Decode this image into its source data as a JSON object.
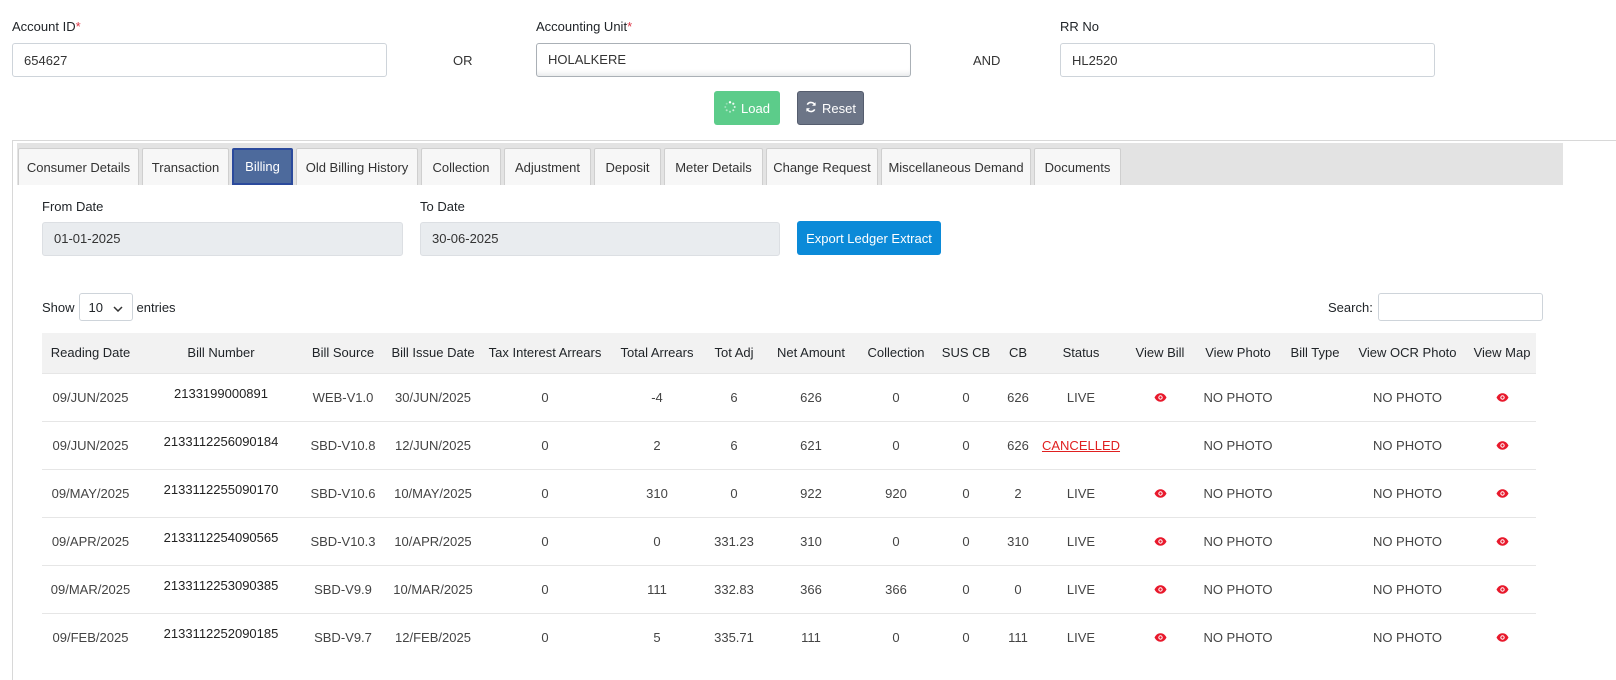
{
  "form": {
    "account_id": {
      "label": "Account ID",
      "required": "*",
      "value": "654627"
    },
    "or_label": "OR",
    "accounting_unit": {
      "label": "Accounting Unit",
      "required": "*",
      "value": "HOLALKERE"
    },
    "and_label": "AND",
    "rr_no": {
      "label": "RR No",
      "value": "HL2520"
    },
    "load_label": "Load",
    "reset_label": "Reset"
  },
  "tabs": [
    {
      "label": "Consumer Details"
    },
    {
      "label": "Transaction"
    },
    {
      "label": "Billing",
      "active": true
    },
    {
      "label": "Old Billing History"
    },
    {
      "label": "Collection"
    },
    {
      "label": "Adjustment"
    },
    {
      "label": "Deposit"
    },
    {
      "label": "Meter Details"
    },
    {
      "label": "Change Request"
    },
    {
      "label": "Miscellaneous Demand"
    },
    {
      "label": "Documents"
    }
  ],
  "billing": {
    "from_date_label": "From Date",
    "from_date": "01-01-2025",
    "to_date_label": "To Date",
    "to_date": "30-06-2025",
    "export_label": "Export Ledger Extract",
    "show_label": "Show",
    "entries_value": "10",
    "entries_label": "entries",
    "search_label": "Search:"
  },
  "table": {
    "headers": [
      "Reading Date",
      "Bill Number",
      "Bill Source",
      "Bill Issue Date",
      "Tax Interest Arrears",
      "Total Arrears",
      "Tot Adj",
      "Net Amount",
      "Collection",
      "SUS CB",
      "CB",
      "Status",
      "View Bill",
      "View Photo",
      "Bill Type",
      "View OCR Photo",
      "View Map"
    ],
    "rows": [
      {
        "reading_date": "09/JUN/2025",
        "bill_number": "2133199000891",
        "bill_source": "WEB-V1.0",
        "bill_issue_date": "30/JUN/2025",
        "tax_interest_arrears": "0",
        "total_arrears": "-4",
        "tot_adj": "6",
        "net_amount": "626",
        "collection": "0",
        "sus_cb": "0",
        "cb": "626",
        "status": "LIVE",
        "view_bill": true,
        "view_photo": "NO PHOTO",
        "bill_type": "",
        "view_ocr_photo": "NO PHOTO",
        "view_map": true
      },
      {
        "reading_date": "09/JUN/2025",
        "bill_number": "2133112256090184",
        "bill_source": "SBD-V10.8",
        "bill_issue_date": "12/JUN/2025",
        "tax_interest_arrears": "0",
        "total_arrears": "2",
        "tot_adj": "6",
        "net_amount": "621",
        "collection": "0",
        "sus_cb": "0",
        "cb": "626",
        "status": "CANCELLED",
        "view_bill": false,
        "view_photo": "NO PHOTO",
        "bill_type": "",
        "view_ocr_photo": "NO PHOTO",
        "view_map": true
      },
      {
        "reading_date": "09/MAY/2025",
        "bill_number": "2133112255090170",
        "bill_source": "SBD-V10.6",
        "bill_issue_date": "10/MAY/2025",
        "tax_interest_arrears": "0",
        "total_arrears": "310",
        "tot_adj": "0",
        "net_amount": "922",
        "collection": "920",
        "sus_cb": "0",
        "cb": "2",
        "status": "LIVE",
        "view_bill": true,
        "view_photo": "NO PHOTO",
        "bill_type": "",
        "view_ocr_photo": "NO PHOTO",
        "view_map": true
      },
      {
        "reading_date": "09/APR/2025",
        "bill_number": "2133112254090565",
        "bill_source": "SBD-V10.3",
        "bill_issue_date": "10/APR/2025",
        "tax_interest_arrears": "0",
        "total_arrears": "0",
        "tot_adj": "331.23",
        "net_amount": "310",
        "collection": "0",
        "sus_cb": "0",
        "cb": "310",
        "status": "LIVE",
        "view_bill": true,
        "view_photo": "NO PHOTO",
        "bill_type": "",
        "view_ocr_photo": "NO PHOTO",
        "view_map": true
      },
      {
        "reading_date": "09/MAR/2025",
        "bill_number": "2133112253090385",
        "bill_source": "SBD-V9.9",
        "bill_issue_date": "10/MAR/2025",
        "tax_interest_arrears": "0",
        "total_arrears": "111",
        "tot_adj": "332.83",
        "net_amount": "366",
        "collection": "366",
        "sus_cb": "0",
        "cb": "0",
        "status": "LIVE",
        "view_bill": true,
        "view_photo": "NO PHOTO",
        "bill_type": "",
        "view_ocr_photo": "NO PHOTO",
        "view_map": true
      },
      {
        "reading_date": "09/FEB/2025",
        "bill_number": "2133112252090185",
        "bill_source": "SBD-V9.7",
        "bill_issue_date": "12/FEB/2025",
        "tax_interest_arrears": "0",
        "total_arrears": "5",
        "tot_adj": "335.71",
        "net_amount": "111",
        "collection": "0",
        "sus_cb": "0",
        "cb": "111",
        "status": "LIVE",
        "view_bill": true,
        "view_photo": "NO PHOTO",
        "bill_type": "",
        "view_ocr_photo": "NO PHOTO",
        "view_map": true
      }
    ]
  },
  "colors": {
    "accent_blue": "#0b8ad8",
    "load_green": "#5ccc8a",
    "reset_gray": "#6c7587",
    "active_tab": "#4d6a9c",
    "cancel_red": "#e02020",
    "eye_red": "#e8192c"
  }
}
